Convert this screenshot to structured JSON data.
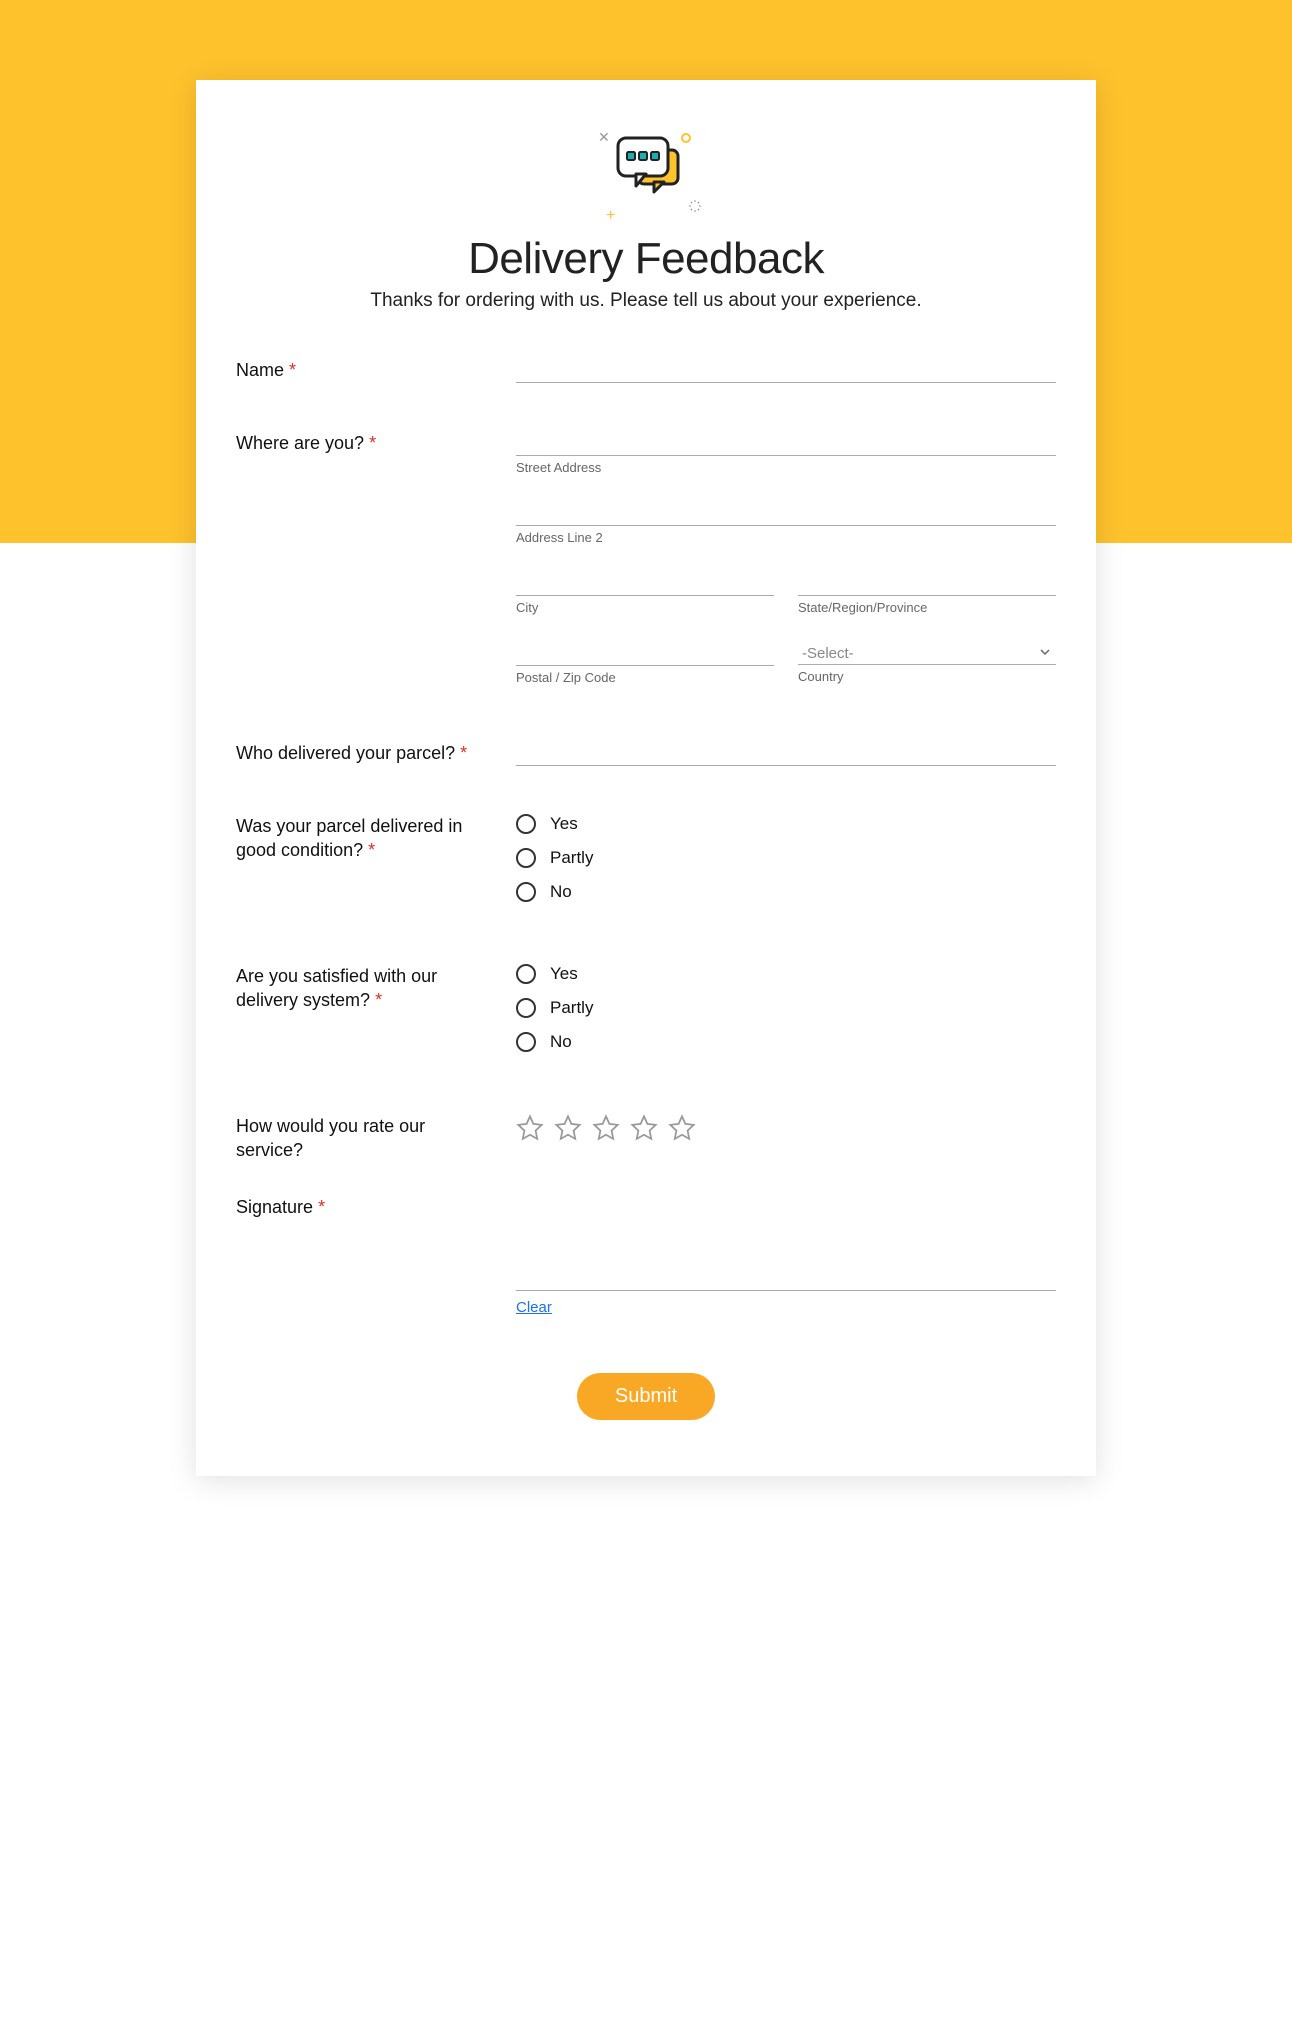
{
  "colors": {
    "accent": "#fec22d",
    "submit": "#f9a825",
    "link": "#1a73e8",
    "required": "#d93025"
  },
  "header": {
    "title": "Delivery Feedback",
    "subtitle": "Thanks for ordering with us. Please tell us about your experience."
  },
  "fields": {
    "name": {
      "label": "Name",
      "required": "*",
      "value": ""
    },
    "address": {
      "label": "Where are you?",
      "required": "*",
      "street": {
        "value": "",
        "sub": "Street Address"
      },
      "line2": {
        "value": "",
        "sub": "Address Line 2"
      },
      "city": {
        "value": "",
        "sub": "City"
      },
      "state": {
        "value": "",
        "sub": "State/Region/Province"
      },
      "postal": {
        "value": "",
        "sub": "Postal / Zip Code"
      },
      "country": {
        "value": "-Select-",
        "sub": "Country"
      }
    },
    "deliverer": {
      "label": "Who delivered your parcel?",
      "required": "*",
      "value": ""
    },
    "condition": {
      "label": "Was your parcel delivered in good condition?",
      "required": "*",
      "options": {
        "0": "Yes",
        "1": "Partly",
        "2": "No"
      }
    },
    "satisfied": {
      "label": "Are you satisfied with our delivery system?",
      "required": "*",
      "options": {
        "0": "Yes",
        "1": "Partly",
        "2": "No"
      }
    },
    "rating": {
      "label": "How would you rate our service?",
      "stars": 5,
      "value": 0
    },
    "signature": {
      "label": "Signature",
      "required": "*",
      "clear": "Clear"
    }
  },
  "submit": {
    "label": "Submit"
  }
}
